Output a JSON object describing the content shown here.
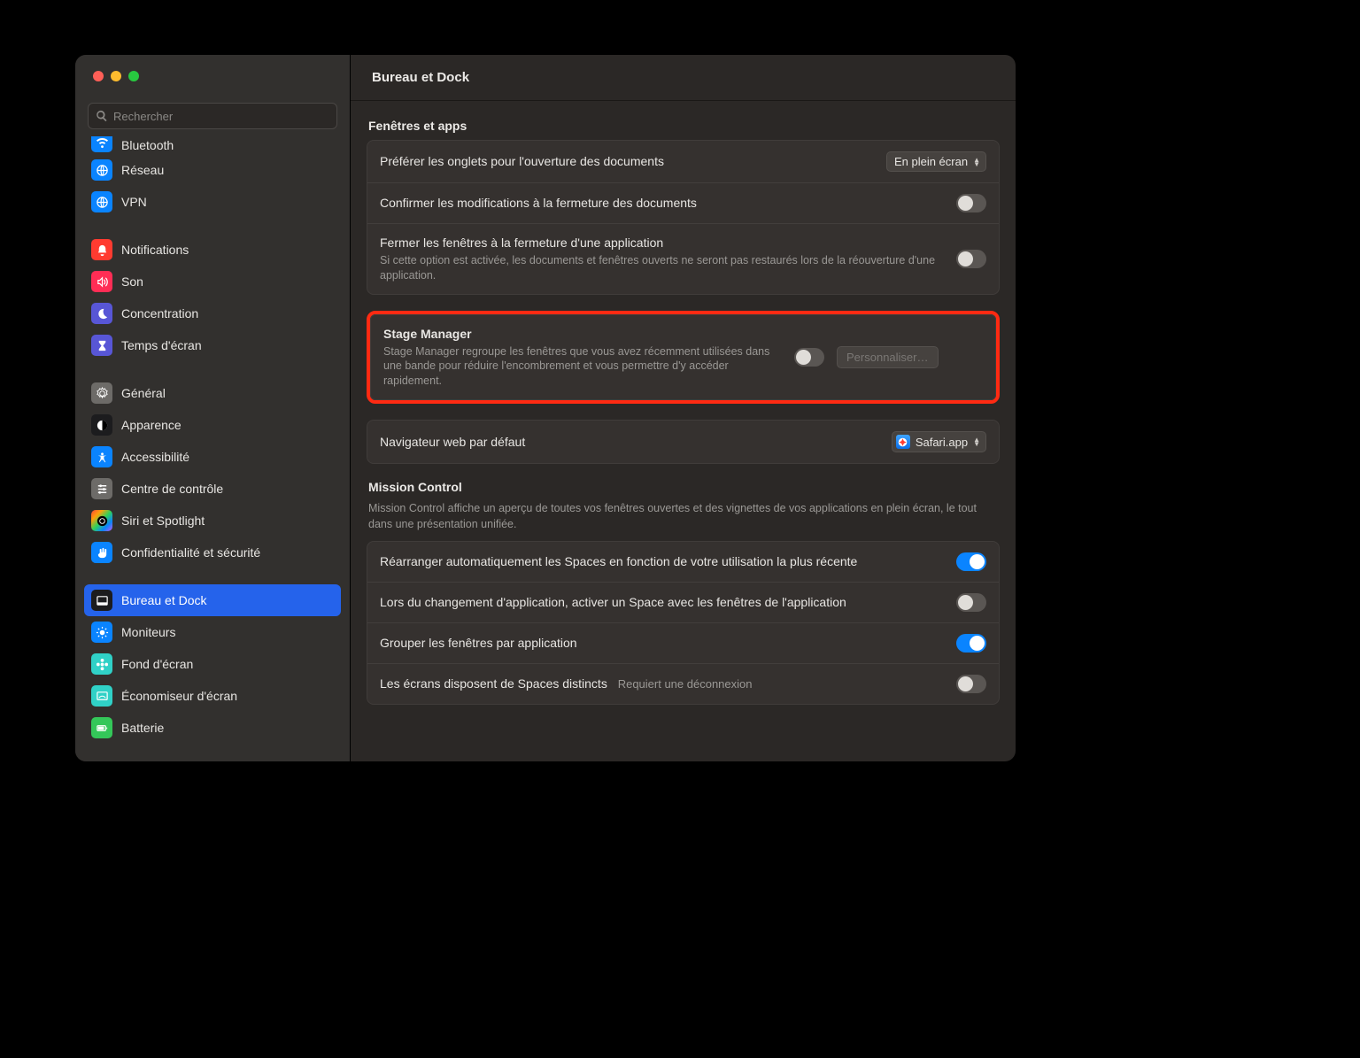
{
  "window_title": "Bureau et Dock",
  "search": {
    "placeholder": "Rechercher"
  },
  "sidebar": {
    "items": [
      {
        "label": "Bluetooth",
        "color": "bg-blue",
        "cut": true
      },
      {
        "label": "Réseau",
        "color": "bg-blue"
      },
      {
        "label": "VPN",
        "color": "bg-blue"
      },
      {
        "gap": true
      },
      {
        "label": "Notifications",
        "color": "bg-red"
      },
      {
        "label": "Son",
        "color": "bg-pink"
      },
      {
        "label": "Concentration",
        "color": "bg-indigo"
      },
      {
        "label": "Temps d'écran",
        "color": "bg-indigo"
      },
      {
        "gap": true
      },
      {
        "label": "Général",
        "color": "bg-gray"
      },
      {
        "label": "Apparence",
        "color": "bg-dark"
      },
      {
        "label": "Accessibilité",
        "color": "bg-blue"
      },
      {
        "label": "Centre de contrôle",
        "color": "bg-gray"
      },
      {
        "label": "Siri et Spotlight",
        "color": "bg-grad"
      },
      {
        "label": "Confidentialité et sécurité",
        "color": "bg-blue"
      },
      {
        "gap": true
      },
      {
        "label": "Bureau et Dock",
        "color": "bg-dark",
        "selected": true
      },
      {
        "label": "Moniteurs",
        "color": "bg-blue"
      },
      {
        "label": "Fond d'écran",
        "color": "bg-teal"
      },
      {
        "label": "Économiseur d'écran",
        "color": "bg-teal"
      },
      {
        "label": "Batterie",
        "color": "bg-green"
      }
    ]
  },
  "sections": {
    "windowsApps": {
      "title": "Fenêtres et apps",
      "rows": {
        "tabsPref": {
          "label": "Préférer les onglets pour l'ouverture des documents",
          "value": "En plein écran"
        },
        "confirmClose": {
          "label": "Confirmer les modifications à la fermeture des documents",
          "on": false
        },
        "closeWindows": {
          "label": "Fermer les fenêtres à la fermeture d'une application",
          "sub": "Si cette option est activée, les documents et fenêtres ouverts ne seront pas restaurés lors de la réouverture d'une application.",
          "on": false
        }
      }
    },
    "stageManager": {
      "label": "Stage Manager",
      "sub": "Stage Manager regroupe les fenêtres que vous avez récemment utilisées dans une bande pour réduire l'encombrement et vous permettre d'y accéder rapidement.",
      "on": false,
      "button": "Personnaliser…"
    },
    "defaultBrowser": {
      "label": "Navigateur web par défaut",
      "value": "Safari.app"
    },
    "missionControl": {
      "title": "Mission Control",
      "sub": "Mission Control affiche un aperçu de toutes vos fenêtres ouvertes et des vignettes de vos applications en plein écran, le tout dans une présentation unifiée.",
      "rows": {
        "rearrange": {
          "label": "Réarranger automatiquement les Spaces en fonction de votre utilisation la plus récente",
          "on": true
        },
        "switchSpace": {
          "label": "Lors du changement d'application, activer un Space avec les fenêtres de l'application",
          "on": false
        },
        "groupByApp": {
          "label": "Grouper les fenêtres par application",
          "on": true
        },
        "separateSpaces": {
          "label": "Les écrans disposent de Spaces distincts",
          "hint": "Requiert une déconnexion",
          "on": false
        }
      }
    }
  }
}
